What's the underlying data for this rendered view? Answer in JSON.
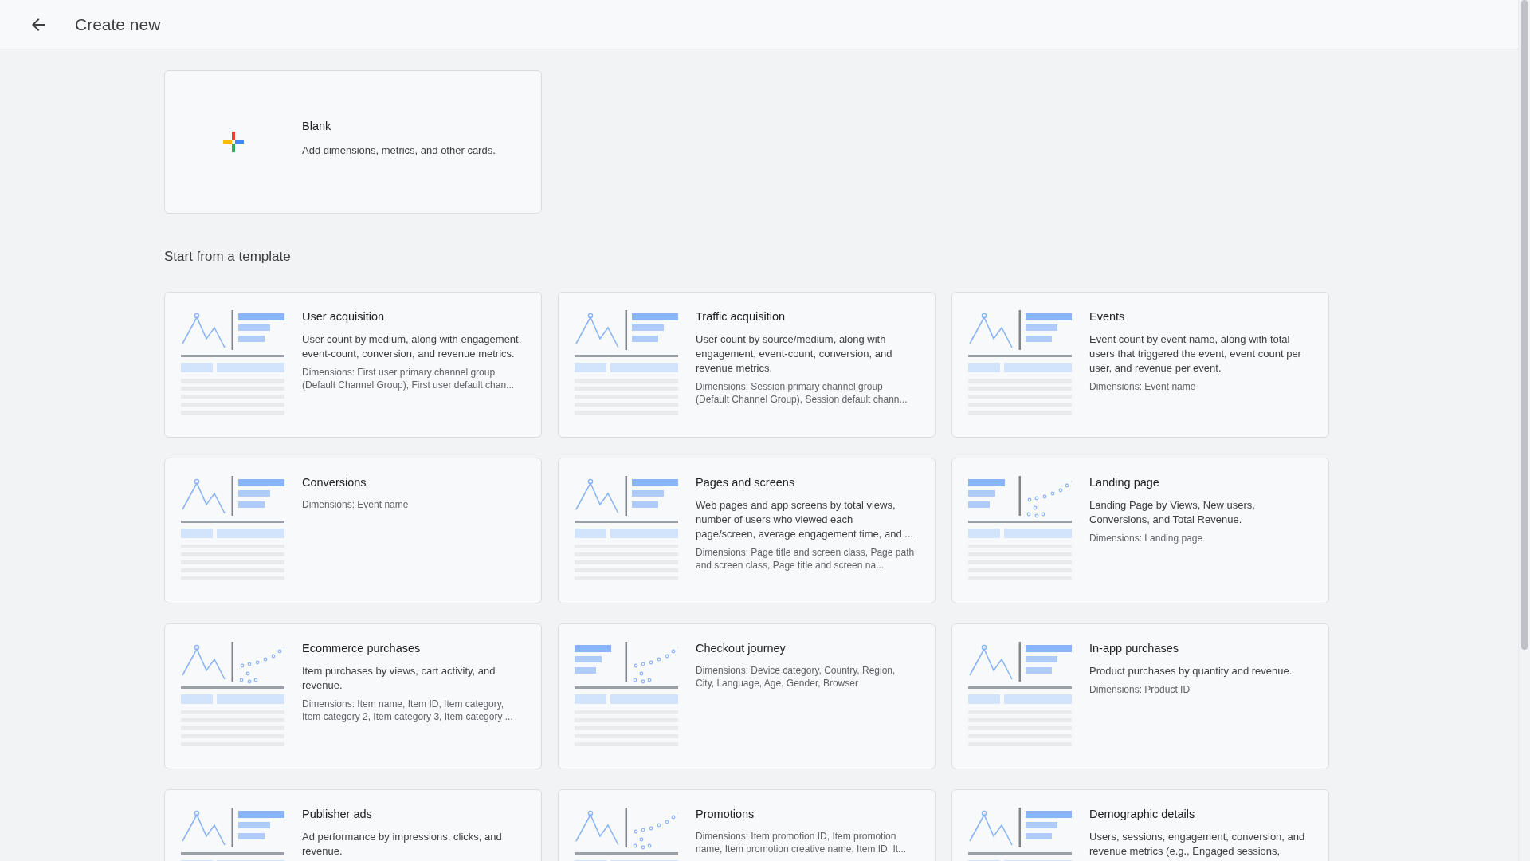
{
  "header": {
    "title": "Create new"
  },
  "blank_card": {
    "title": "Blank",
    "description": "Add dimensions, metrics, and other cards."
  },
  "section_title": "Start from a template",
  "templates": [
    {
      "title": "User acquisition",
      "kind": "line-bars",
      "description": "User count by medium, along with engagement, event-count, conversion, and revenue metrics.",
      "dimensions": "Dimensions: First user primary channel group (Default Channel Group), First user default chan..."
    },
    {
      "title": "Traffic acquisition",
      "kind": "line-bars",
      "description": "User count by source/medium, along with engagement, event-count, conversion, and revenue metrics.",
      "dimensions": "Dimensions: Session primary channel group (Default Channel Group), Session default chann..."
    },
    {
      "title": "Events",
      "kind": "line-bars",
      "description": "Event count by event name, along with total users that triggered the event, event count per user, and revenue per event.",
      "dimensions": "Dimensions: Event name"
    },
    {
      "title": "Conversions",
      "kind": "line-bars",
      "dimensions": "Dimensions: Event name"
    },
    {
      "title": "Pages and screens",
      "kind": "line-bars",
      "description": "Web pages and app screens by total views, number of users who viewed each page/screen, average engagement time, and ...",
      "dimensions": "Dimensions: Page title and screen class, Page path and screen class, Page title and screen na..."
    },
    {
      "title": "Landing page",
      "kind": "bars-scatter",
      "description": "Landing Page by Views, New users, Conversions, and Total Revenue.",
      "dimensions": "Dimensions: Landing page"
    },
    {
      "title": "Ecommerce purchases",
      "kind": "line-scatter",
      "description": "Item purchases by views, cart activity, and revenue.",
      "dimensions": "Dimensions: Item name, Item ID, Item category, Item category 2, Item category 3, Item category ..."
    },
    {
      "title": "Checkout journey",
      "kind": "bars-scatter",
      "dimensions": "Dimensions: Device category, Country, Region, City, Language, Age, Gender, Browser"
    },
    {
      "title": "In-app purchases",
      "kind": "line-bars",
      "description": "Product purchases by quantity and revenue.",
      "dimensions": "Dimensions: Product ID"
    },
    {
      "title": "Publisher ads",
      "kind": "line-bars",
      "description": "Ad performance by impressions, clicks, and revenue."
    },
    {
      "title": "Promotions",
      "kind": "line-scatter",
      "dimensions": "Dimensions: Item promotion ID, Item promotion name, Item promotion creative name, Item ID, It..."
    },
    {
      "title": "Demographic details",
      "kind": "line-bars",
      "description": "Users, sessions, engagement, conversion, and revenue metrics (e.g., Engaged sessions,"
    }
  ]
}
